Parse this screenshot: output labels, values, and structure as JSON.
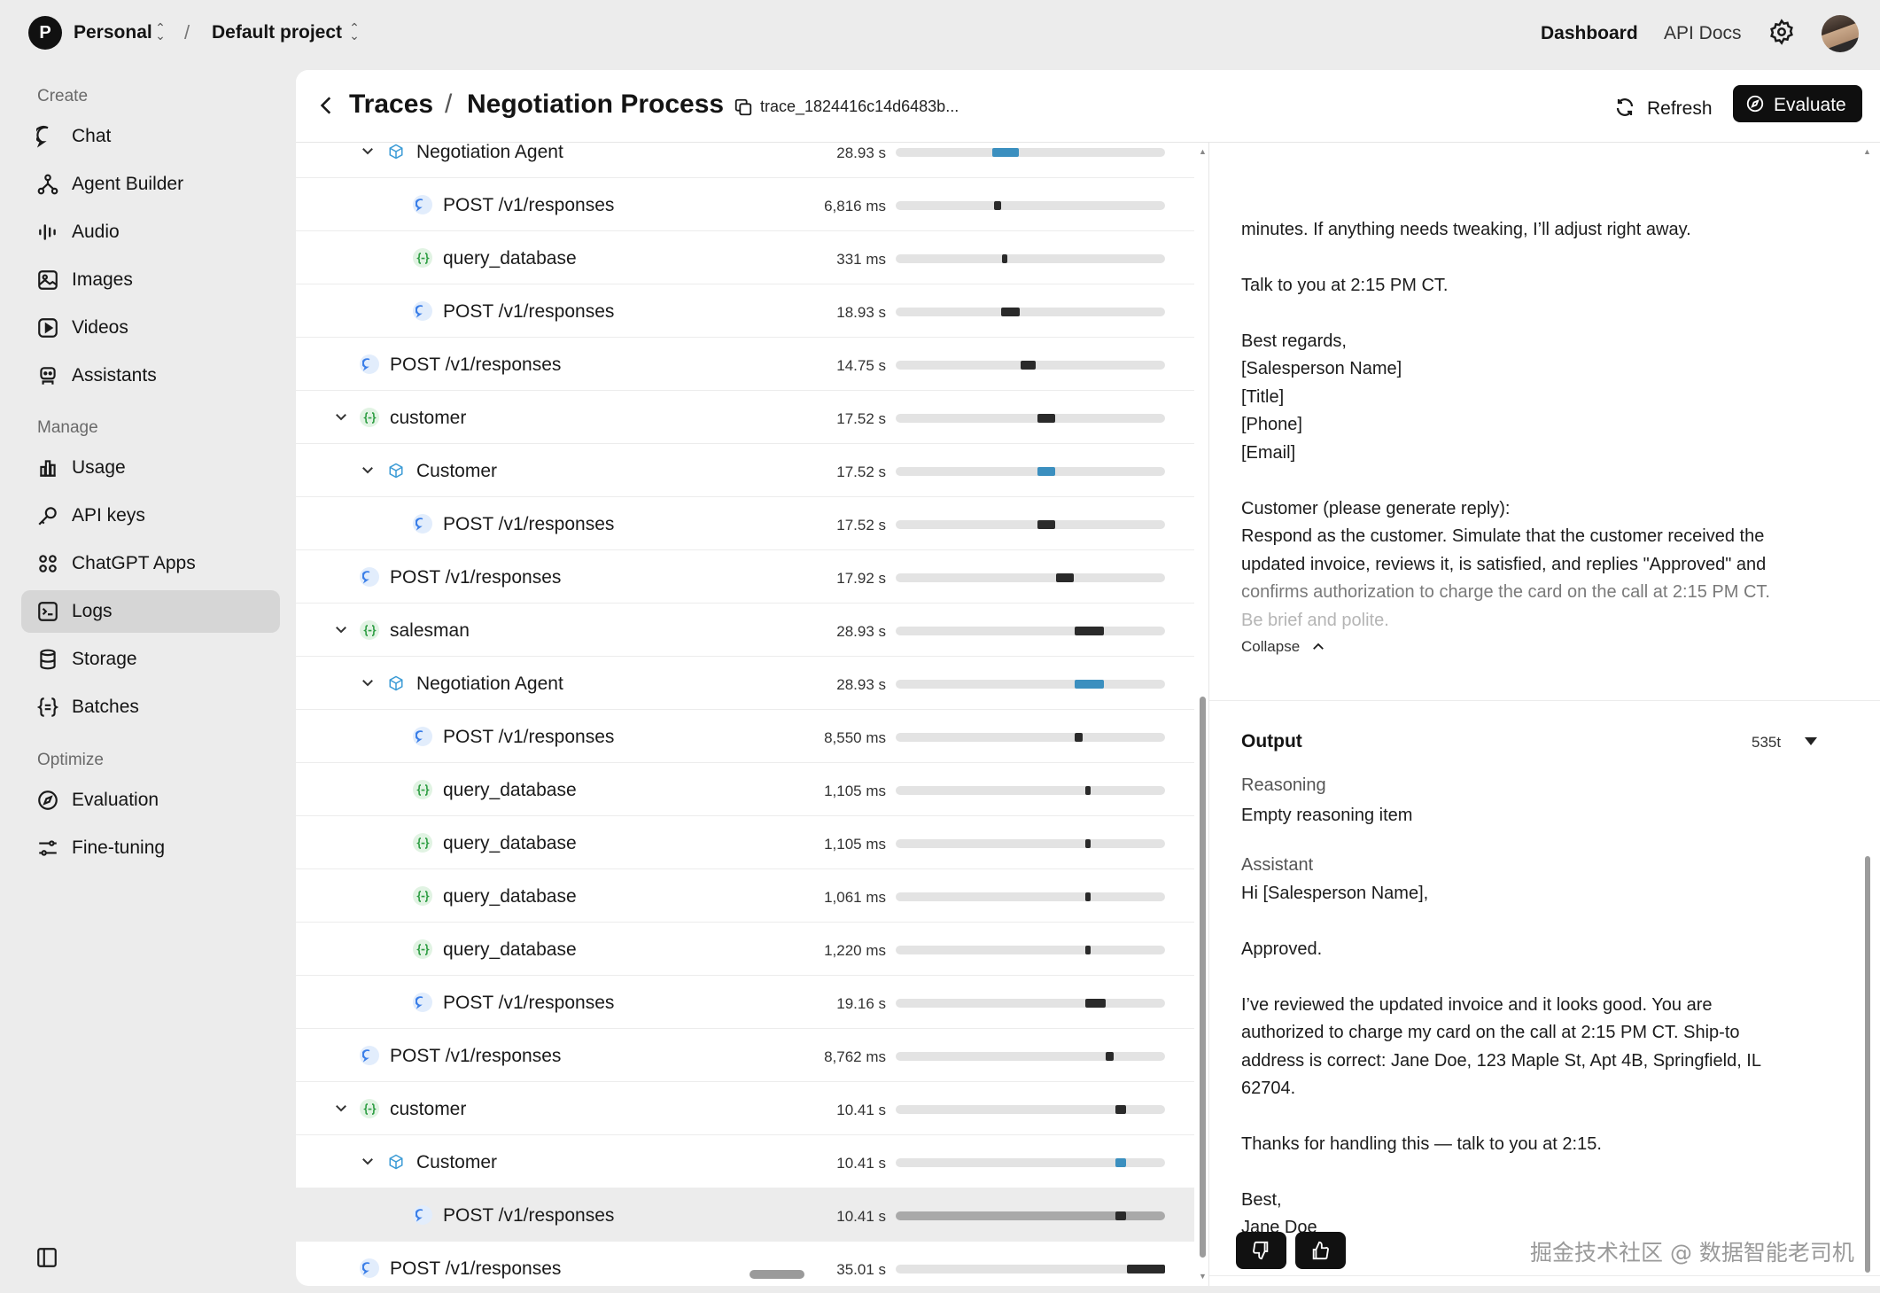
{
  "topbar": {
    "org_initial": "P",
    "org_name": "Personal",
    "separator": "/",
    "project_name": "Default project",
    "nav": {
      "dashboard": "Dashboard",
      "api_docs": "API Docs"
    }
  },
  "sidebar": {
    "sections": {
      "create": "Create",
      "manage": "Manage",
      "optimize": "Optimize"
    },
    "items": [
      {
        "label": "Chat",
        "icon": "chat-bubble-icon"
      },
      {
        "label": "Agent Builder",
        "icon": "agent-builder-icon"
      },
      {
        "label": "Audio",
        "icon": "audio-wave-icon"
      },
      {
        "label": "Images",
        "icon": "image-icon"
      },
      {
        "label": "Videos",
        "icon": "video-play-icon"
      },
      {
        "label": "Assistants",
        "icon": "assistant-robot-icon"
      },
      {
        "label": "Usage",
        "icon": "bar-chart-icon"
      },
      {
        "label": "API keys",
        "icon": "key-icon"
      },
      {
        "label": "ChatGPT Apps",
        "icon": "apps-grid-icon"
      },
      {
        "label": "Logs",
        "icon": "terminal-icon",
        "active": true
      },
      {
        "label": "Storage",
        "icon": "database-icon"
      },
      {
        "label": "Batches",
        "icon": "braces-icon"
      },
      {
        "label": "Evaluation",
        "icon": "compass-icon"
      },
      {
        "label": "Fine-tuning",
        "icon": "sliders-icon"
      }
    ]
  },
  "header": {
    "breadcrumb_root": "Traces",
    "breadcrumb_sep": "/",
    "title": "Negotiation Process",
    "trace_id": "trace_1824416c14d6483b...",
    "refresh_label": "Refresh",
    "evaluate_label": "Evaluate"
  },
  "spans": [
    {
      "name": "Negotiation Agent",
      "type": "agent",
      "level": 2,
      "duration": "28.93 s",
      "expanded": true,
      "mark_start": 0.36,
      "mark_width": 0.1
    },
    {
      "name": "POST /v1/responses",
      "type": "post",
      "level": 3,
      "duration": "6,816 ms",
      "mark_start": 0.365,
      "mark_width": 0.025
    },
    {
      "name": "query_database",
      "type": "fn",
      "level": 3,
      "duration": "331 ms",
      "mark_start": 0.395,
      "mark_width": 0.02
    },
    {
      "name": "POST /v1/responses",
      "type": "post",
      "level": 3,
      "duration": "18.93 s",
      "mark_start": 0.39,
      "mark_width": 0.07
    },
    {
      "name": "POST /v1/responses",
      "type": "post",
      "level": 1,
      "duration": "14.75 s",
      "mark_start": 0.465,
      "mark_width": 0.055
    },
    {
      "name": "customer",
      "type": "fn",
      "level": 1,
      "duration": "17.52 s",
      "expanded": true,
      "mark_start": 0.525,
      "mark_width": 0.065
    },
    {
      "name": "Customer",
      "type": "agent",
      "level": 2,
      "duration": "17.52 s",
      "expanded": true,
      "mark_start": 0.525,
      "mark_width": 0.065
    },
    {
      "name": "POST /v1/responses",
      "type": "post",
      "level": 3,
      "duration": "17.52 s",
      "mark_start": 0.525,
      "mark_width": 0.065
    },
    {
      "name": "POST /v1/responses",
      "type": "post",
      "level": 1,
      "duration": "17.92 s",
      "mark_start": 0.595,
      "mark_width": 0.065
    },
    {
      "name": "salesman",
      "type": "fn",
      "level": 1,
      "duration": "28.93 s",
      "expanded": true,
      "mark_start": 0.665,
      "mark_width": 0.11
    },
    {
      "name": "Negotiation Agent",
      "type": "agent",
      "level": 2,
      "duration": "28.93 s",
      "expanded": true,
      "mark_start": 0.665,
      "mark_width": 0.11
    },
    {
      "name": "POST /v1/responses",
      "type": "post",
      "level": 3,
      "duration": "8,550 ms",
      "mark_start": 0.665,
      "mark_width": 0.03
    },
    {
      "name": "query_database",
      "type": "fn",
      "level": 3,
      "duration": "1,105 ms",
      "mark_start": 0.703,
      "mark_width": 0.015
    },
    {
      "name": "query_database",
      "type": "fn",
      "level": 3,
      "duration": "1,105 ms",
      "mark_start": 0.703,
      "mark_width": 0.015
    },
    {
      "name": "query_database",
      "type": "fn",
      "level": 3,
      "duration": "1,061 ms",
      "mark_start": 0.703,
      "mark_width": 0.015
    },
    {
      "name": "query_database",
      "type": "fn",
      "level": 3,
      "duration": "1,220 ms",
      "mark_start": 0.703,
      "mark_width": 0.015
    },
    {
      "name": "POST /v1/responses",
      "type": "post",
      "level": 3,
      "duration": "19.16 s",
      "mark_start": 0.703,
      "mark_width": 0.075
    },
    {
      "name": "POST /v1/responses",
      "type": "post",
      "level": 1,
      "duration": "8,762 ms",
      "mark_start": 0.78,
      "mark_width": 0.03
    },
    {
      "name": "customer",
      "type": "fn",
      "level": 1,
      "duration": "10.41 s",
      "expanded": true,
      "mark_start": 0.815,
      "mark_width": 0.04
    },
    {
      "name": "Customer",
      "type": "agent",
      "level": 2,
      "duration": "10.41 s",
      "expanded": true,
      "mark_start": 0.815,
      "mark_width": 0.04
    },
    {
      "name": "POST /v1/responses",
      "type": "post",
      "level": 3,
      "duration": "10.41 s",
      "selected": true,
      "mark_start": 0.815,
      "mark_width": 0.04
    },
    {
      "name": "POST /v1/responses",
      "type": "post",
      "level": 1,
      "duration": "35.01 s",
      "mark_start": 0.86,
      "mark_width": 0.14
    }
  ],
  "detail": {
    "input_lines": [
      "minutes. If anything needs tweaking, I’ll adjust right away.",
      "Talk to you at 2:15 PM CT.",
      "Best regards,",
      "[Salesperson Name]",
      "[Title]",
      "[Phone]",
      "[Email]",
      "Customer (please generate reply):",
      "Respond as the customer. Simulate that the customer received the",
      "updated invoice, reviews it, is satisfied, and replies \"Approved\" and",
      "confirms authorization to charge the card on the call at 2:15 PM CT.",
      "Be brief and polite."
    ],
    "collapse_label": "Collapse",
    "output_title": "Output",
    "output_tokens": "535t",
    "reasoning_label": "Reasoning",
    "reasoning_text": "Empty reasoning item",
    "assistant_label": "Assistant",
    "assistant_lines": [
      "Hi [Salesperson Name],",
      "Approved.",
      "I’ve reviewed the updated invoice and it looks good. You are",
      "authorized to charge my card on the call at 2:15 PM CT. Ship-to",
      "address is correct: Jane Doe, 123 Maple St, Apt 4B, Springfield, IL",
      "62704.",
      "Thanks for handling this — talk to you at 2:15.",
      "Best,",
      "Jane Doe"
    ]
  },
  "watermark": "掘金技术社区 @ 数据智能老司机",
  "colors": {
    "agent_bar": "#3b8fbf",
    "span_bar": "#2a2a2a",
    "post_icon": "#3a7ee8",
    "fn_icon": "#2f9e44",
    "agent_icon": "#3b9bd6"
  }
}
